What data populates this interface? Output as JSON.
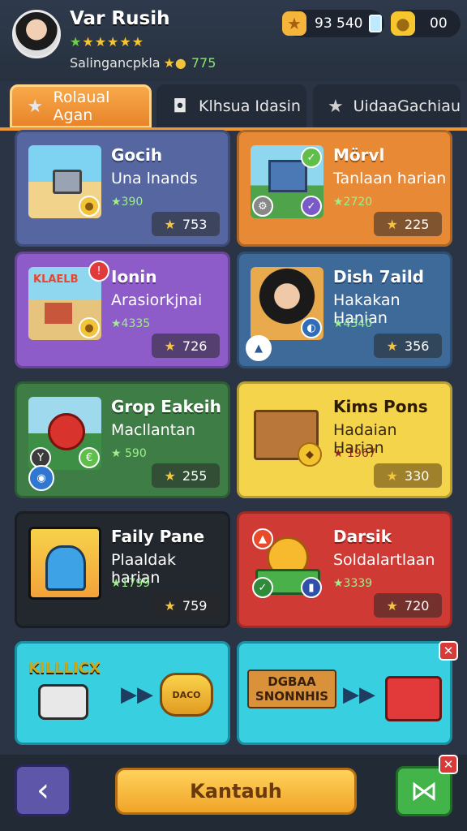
{
  "player": {
    "name": "Var Rusih",
    "stars": "★★★★★",
    "subtitle": "Salingancpkla",
    "subtitle_value": "775"
  },
  "currencies": [
    {
      "icon": "gold-bolt-icon",
      "value": "93 540"
    },
    {
      "icon": "cheese-icon",
      "value": "00"
    }
  ],
  "tabs": [
    {
      "label": "Rolaual Agan",
      "icon": "star-icon"
    },
    {
      "label": "Klhsua Idasin",
      "icon": "square-icon"
    },
    {
      "label": "UidaaGachiau",
      "icon": "star-icon"
    }
  ],
  "cards": [
    {
      "title": "Gocih",
      "subtitle": "Una lnands",
      "score": "★390",
      "badge": "753"
    },
    {
      "title": "Mörvl",
      "subtitle": "Tanlaan harian",
      "score": "★2720",
      "badge": "225"
    },
    {
      "title": "Ionin",
      "subtitle": "Arasiorkjnai",
      "score": "★4335",
      "badge": "726"
    },
    {
      "title": "Dish 7aild",
      "subtitle": "Hakakan Hanian",
      "score": "★4340",
      "badge": "356"
    },
    {
      "title": "Grop Eakeih",
      "subtitle": "Macllantan",
      "score": "★ 590",
      "badge": "255"
    },
    {
      "title": "Kims Pons",
      "subtitle": "Hadaian Harian",
      "score": "★ 1967",
      "badge": "330"
    },
    {
      "title": "Faily Pane",
      "subtitle": "Plaaldak harian",
      "score": "★1799",
      "badge": "759"
    },
    {
      "title": "Darsik",
      "subtitle": "Soldalartlaan",
      "score": "★3339",
      "badge": "720"
    }
  ],
  "banners": [
    {
      "text": "KILLLICX",
      "reward": "DACO"
    },
    {
      "text": "DGBAA SNONNHIS",
      "reward": ""
    }
  ],
  "bottom": {
    "main_button": "Kantauh"
  },
  "colors": {
    "accent": "#f0962f",
    "background": "#2b3444"
  }
}
